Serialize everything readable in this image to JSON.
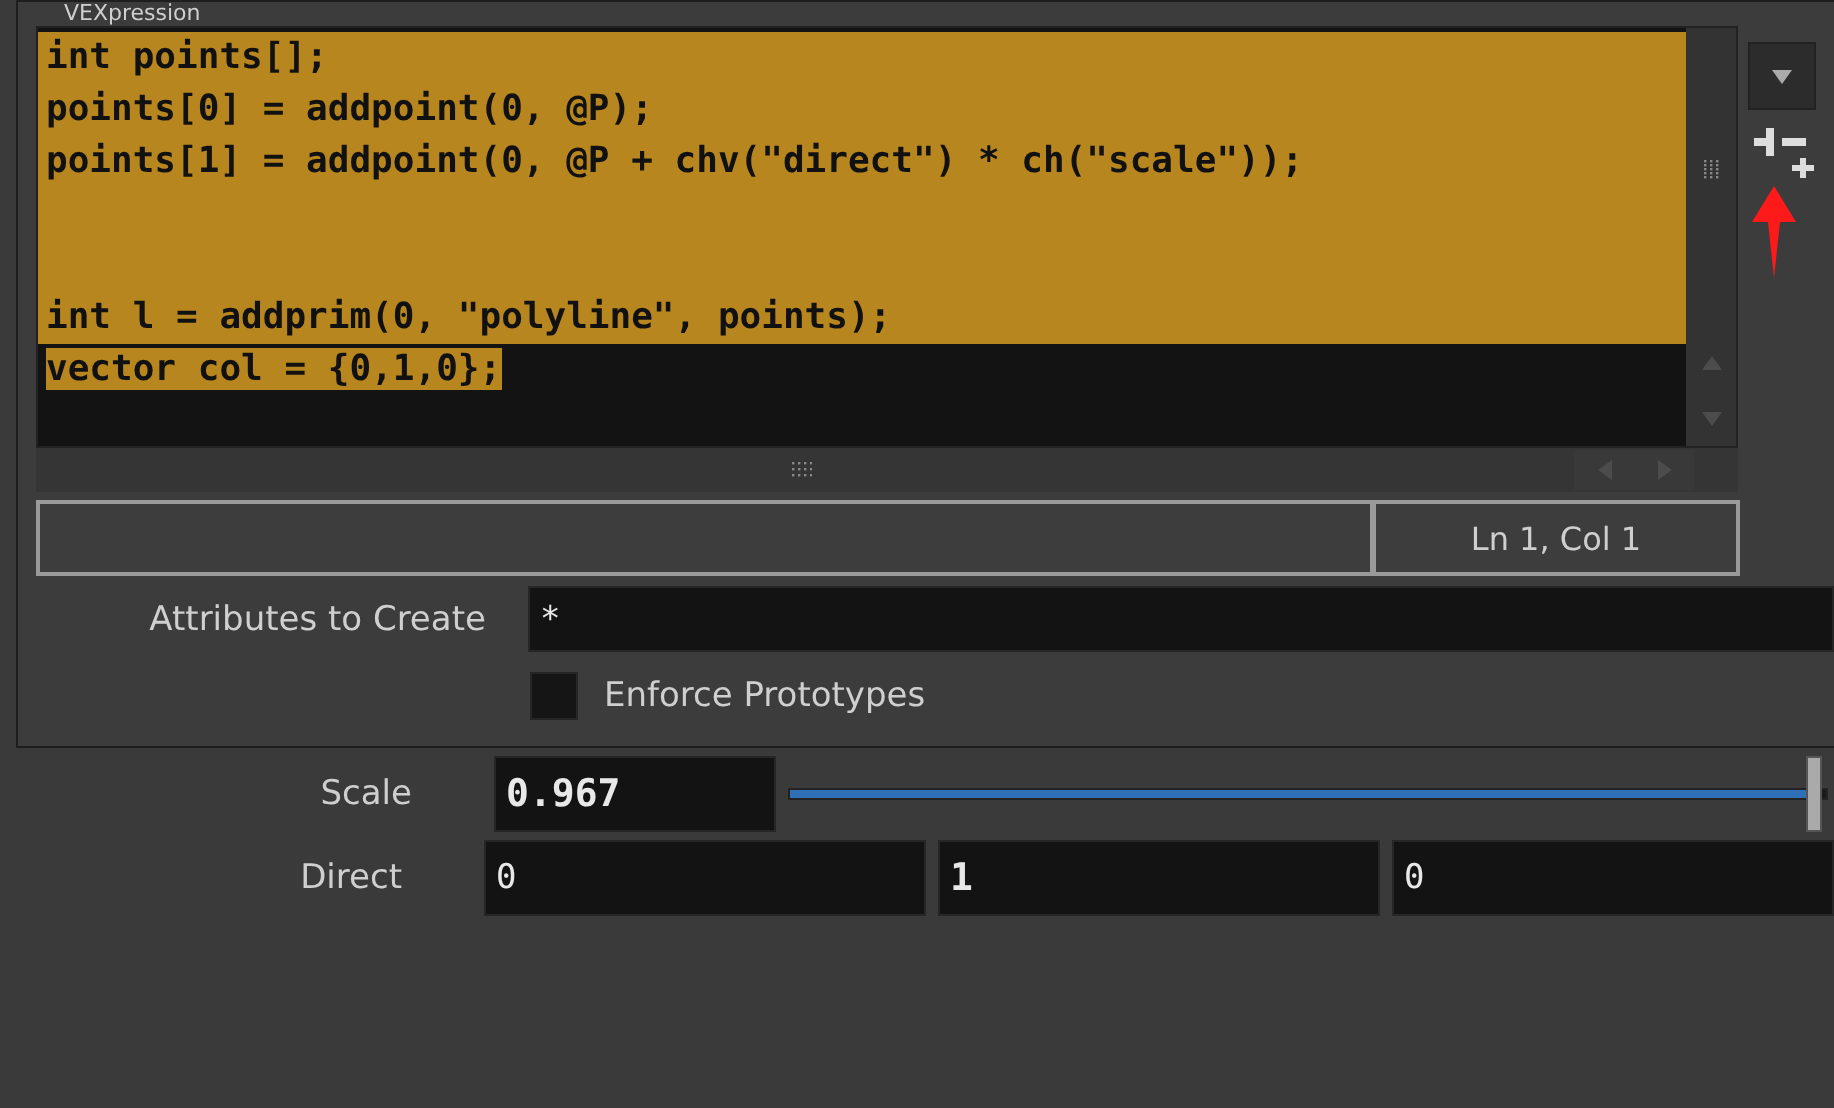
{
  "panel": {
    "title": "VEXpression",
    "code_lines": [
      {
        "text": "int points[];",
        "selected": true
      },
      {
        "text": "points[0] = addpoint(0, @P);",
        "selected": true
      },
      {
        "text": "points[1] = addpoint(0, @P + chv(\"direct\") * ch(\"scale\"));",
        "selected": true
      },
      {
        "selected": true
      },
      {
        "selected": true
      },
      {
        "text": "int l = addprim(0, \"polyline\", points);",
        "selected": true
      },
      {
        "text": "vector col = {0,1,0};",
        "selected": true
      }
    ],
    "status": "Ln 1, Col 1",
    "attributes": {
      "label": "Attributes to Create",
      "value": "*"
    },
    "enforce": {
      "label": "Enforce Prototypes",
      "checked": false
    }
  },
  "scale": {
    "label": "Scale",
    "value": "0.967",
    "level": 0.985
  },
  "direct": {
    "label": "Direct",
    "values": [
      "0",
      "1",
      "0"
    ]
  }
}
